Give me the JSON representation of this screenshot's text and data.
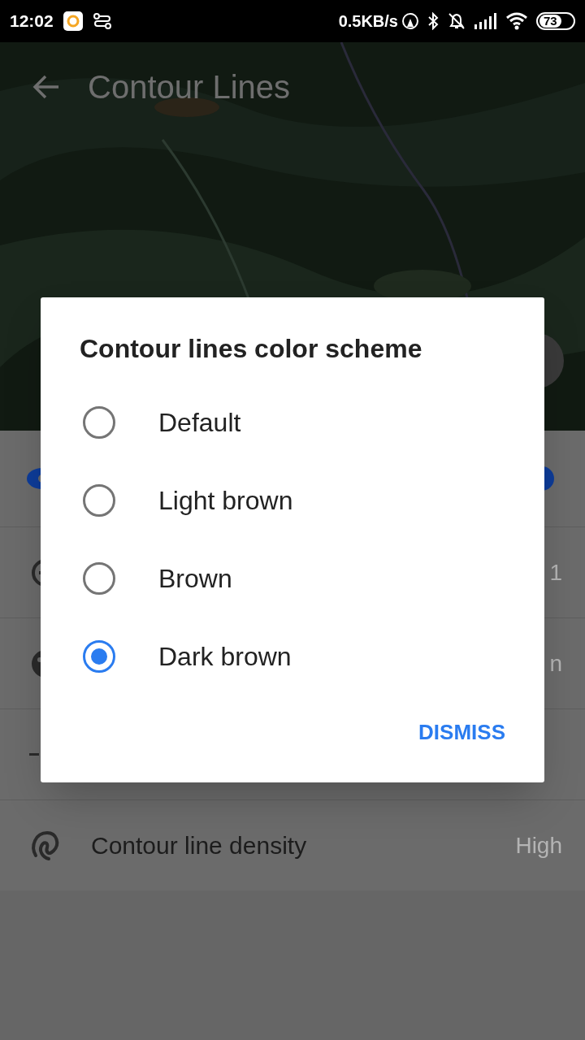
{
  "status_bar": {
    "time": "12:02",
    "speed": "0.5KB/s",
    "battery": "73"
  },
  "header": {
    "title": "Contour Lines"
  },
  "settings": [
    {
      "kind": "toggle",
      "on": true
    },
    {
      "kind": "minus",
      "value": "1"
    },
    {
      "kind": "palette",
      "value": "n"
    },
    {
      "kind": "line"
    },
    {
      "kind": "density",
      "label": "Contour line density",
      "value": "High"
    }
  ],
  "dialog": {
    "title": "Contour lines color scheme",
    "options": [
      {
        "label": "Default",
        "selected": false
      },
      {
        "label": "Light brown",
        "selected": false
      },
      {
        "label": "Brown",
        "selected": false
      },
      {
        "label": "Dark brown",
        "selected": true
      }
    ],
    "button": "DISMISS"
  }
}
